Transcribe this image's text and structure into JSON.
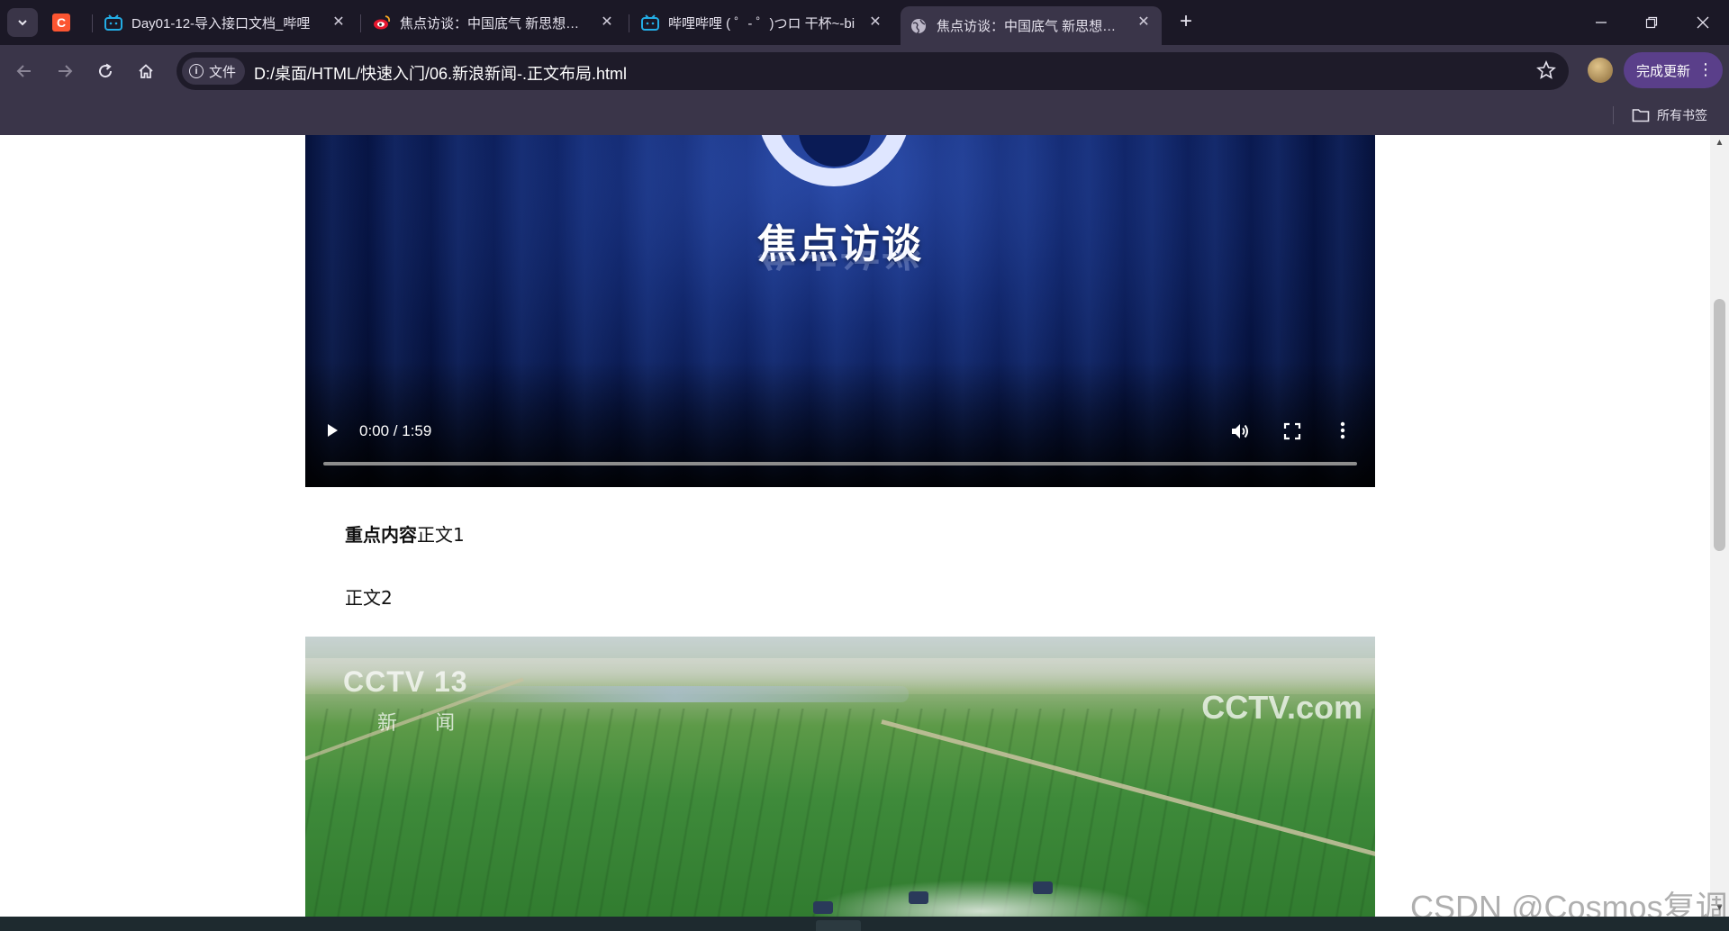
{
  "browser": {
    "tabs": [
      {
        "title": "",
        "icon": "csdn-icon",
        "active": false
      },
      {
        "title": "Day01-12-导入接口文档_哔哩",
        "icon": "bilibili-icon",
        "active": false
      },
      {
        "title": "焦点访谈：中国底气 新思想夯实",
        "icon": "weibo-icon",
        "active": false
      },
      {
        "title": "哔哩哔哩 ( ゜- ゜)つロ 干杯~-bi",
        "icon": "bilibili-icon",
        "active": false
      },
      {
        "title": "焦点访谈：中国底气 新思想夯实",
        "icon": "globe-icon",
        "active": true
      }
    ],
    "address_chip": "文件",
    "url": "D:/桌面/HTML/快速入门/06.新浪新闻-.正文布局.html",
    "update_button": "完成更新",
    "bookmarks_all": "所有书签"
  },
  "video": {
    "title": "焦点访谈",
    "time": "0:00 / 1:59",
    "progress": 0
  },
  "article": {
    "para1_strong": "重点内容",
    "para1_rest": "正文1",
    "para2": "正文2"
  },
  "photo": {
    "watermark_left": "CCTV 13",
    "watermark_left_sub": "新 闻",
    "watermark_right": "CCTV.com"
  },
  "page_watermark": "CSDN @Cosmos复调",
  "colors": {
    "tabstrip": "#1b1826",
    "toolbar": "#3a3549",
    "omnibox": "#1e1b29",
    "update_button": "#5a3f8a"
  }
}
